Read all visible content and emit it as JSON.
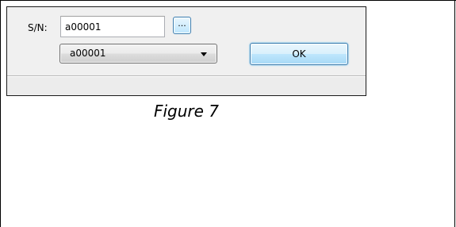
{
  "dialog": {
    "sn_label": "S/N:",
    "sn_value": "a00001",
    "browse_label": "...",
    "combo_value": "a00001",
    "ok_label": "OK"
  },
  "caption": "Figure 7",
  "icons": {
    "dropdown_arrow": "chevron-down-icon"
  }
}
